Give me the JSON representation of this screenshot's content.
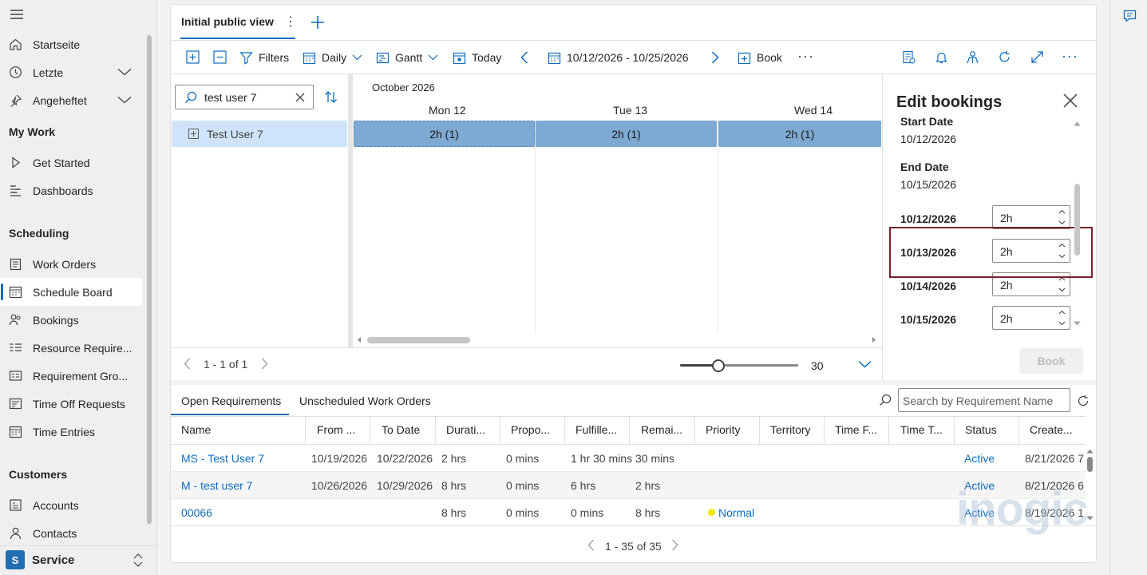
{
  "nav": {
    "items_top": [
      {
        "label": "Startseite",
        "icon": "home-icon"
      },
      {
        "label": "Letzte",
        "icon": "clock-icon"
      },
      {
        "label": "Angeheftet",
        "icon": "pin-icon"
      }
    ],
    "section_mywork": "My Work",
    "items_mywork": [
      {
        "label": "Get Started",
        "icon": "play-icon"
      },
      {
        "label": "Dashboards",
        "icon": "dashboard-icon"
      }
    ],
    "section_scheduling": "Scheduling",
    "items_scheduling": [
      {
        "label": "Work Orders",
        "icon": "clipboard-icon"
      },
      {
        "label": "Schedule Board",
        "icon": "calendar-icon"
      },
      {
        "label": "Bookings",
        "icon": "people-icon"
      },
      {
        "label": "Resource Require...",
        "icon": "list-icon"
      },
      {
        "label": "Requirement Gro...",
        "icon": "group-icon"
      },
      {
        "label": "Time Off Requests",
        "icon": "timeoff-icon"
      },
      {
        "label": "Time Entries",
        "icon": "calendar-icon"
      }
    ],
    "section_customers": "Customers",
    "items_customers": [
      {
        "label": "Accounts",
        "icon": "building-icon"
      },
      {
        "label": "Contacts",
        "icon": "person-icon"
      }
    ],
    "area": {
      "badge": "S",
      "label": "Service"
    }
  },
  "tabs": {
    "active": "Initial public view"
  },
  "toolbar": {
    "filters": "Filters",
    "daily": "Daily",
    "gantt": "Gantt",
    "today": "Today",
    "date_range": "10/12/2026 - 10/25/2026",
    "book": "Book"
  },
  "search": {
    "value": "test user 7"
  },
  "resource": {
    "name": "Test User 7"
  },
  "calendar": {
    "month": "October 2026",
    "days": [
      "Mon 12",
      "Tue 13",
      "Wed 14"
    ],
    "bars": [
      "2h (1)",
      "2h (1)",
      "2h (1)"
    ]
  },
  "pager_resources": "1 - 1 of 1",
  "zoom_value": "30",
  "zoom_fraction": 0.3,
  "edit_bookings": {
    "title": "Edit bookings",
    "start_date_label": "Start Date",
    "start_date": "10/12/2026",
    "end_date_label": "End Date",
    "end_date": "10/15/2026",
    "days": [
      {
        "date": "10/12/2026",
        "hours": "2h"
      },
      {
        "date": "10/13/2026",
        "hours": "2h"
      },
      {
        "date": "10/14/2026",
        "hours": "2h"
      },
      {
        "date": "10/15/2026",
        "hours": "2h"
      }
    ],
    "book_button": "Book"
  },
  "bottom": {
    "tabs": [
      "Open Requirements",
      "Unscheduled Work Orders"
    ],
    "search_placeholder": "Search by Requirement Name",
    "columns": [
      "Name",
      "From ...",
      "To Date",
      "Durati...",
      "Propo...",
      "Fulfille...",
      "Remai...",
      "Priority",
      "Territory",
      "Time F...",
      "Time T...",
      "Status",
      "Create..."
    ],
    "rows": [
      {
        "name": "MS - Test User 7",
        "from": "10/19/2026",
        "to": "10/22/2026",
        "duration": "2 hrs",
        "proposed": "0 mins",
        "fulfilled": "1 hr 30 mins",
        "remaining": "30 mins",
        "priority": "",
        "status": "Active",
        "created": "8/21/2026 7"
      },
      {
        "name": "M - test user 7",
        "from": "10/26/2026",
        "to": "10/29/2026",
        "duration": "8 hrs",
        "proposed": "0 mins",
        "fulfilled": "6 hrs",
        "remaining": "2 hrs",
        "priority": "",
        "status": "Active",
        "created": "8/21/2026 6"
      },
      {
        "name": "00066",
        "from": "",
        "to": "",
        "duration": "8 hrs",
        "proposed": "0 mins",
        "fulfilled": "0 mins",
        "remaining": "8 hrs",
        "priority": "Normal",
        "status": "Active",
        "created": "8/19/2026 1"
      }
    ],
    "pager": "1 - 35 of 35"
  },
  "watermark": "inogic",
  "colors": {
    "accent": "#0f6cbd",
    "bar": "#7ea9d2",
    "highlight_box": "#7a1f2b",
    "priority_normal": "#f2e600"
  }
}
